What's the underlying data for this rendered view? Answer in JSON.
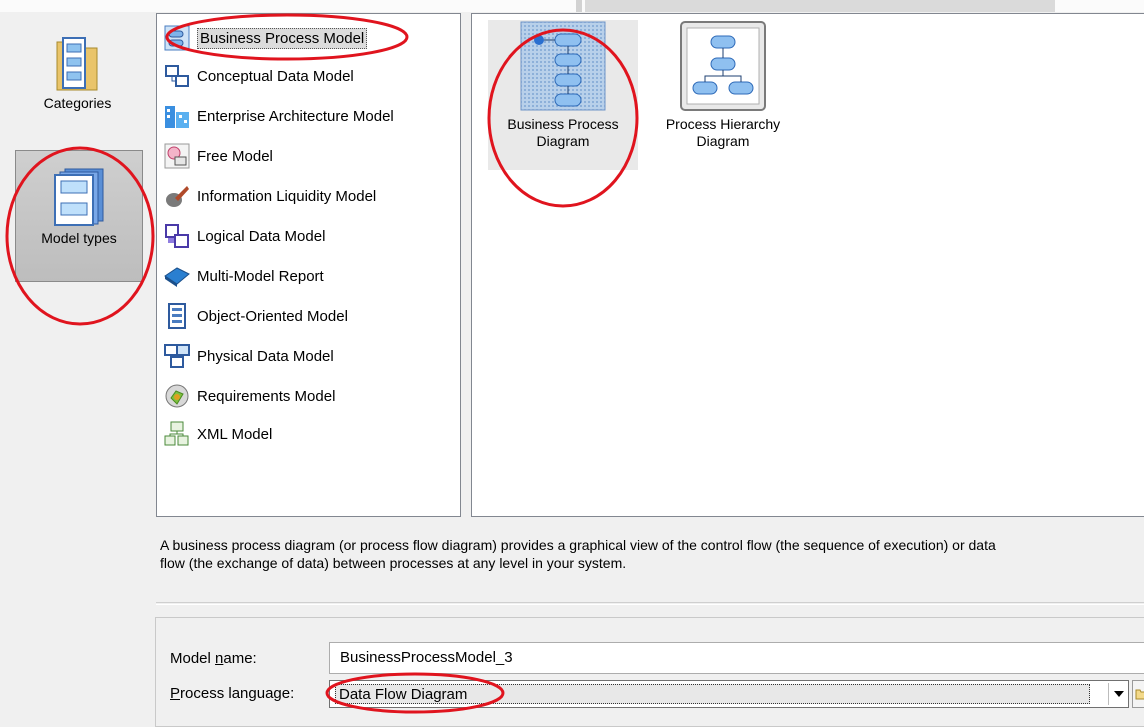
{
  "categories_bar": {
    "items": [
      {
        "label": "Categories",
        "icon": "folder-grid-icon"
      },
      {
        "label": "Model types",
        "icon": "stacked-models-icon",
        "selected": true
      }
    ]
  },
  "model_list": {
    "items": [
      {
        "label": "Business Process Model",
        "icon": "business-process-model-icon",
        "selected": true
      },
      {
        "label": "Conceptual Data Model",
        "icon": "conceptual-data-model-icon"
      },
      {
        "label": "Enterprise Architecture Model",
        "icon": "enterprise-architecture-model-icon"
      },
      {
        "label": "Free Model",
        "icon": "free-model-icon"
      },
      {
        "label": "Information Liquidity Model",
        "icon": "information-liquidity-model-icon"
      },
      {
        "label": "Logical Data Model",
        "icon": "logical-data-model-icon"
      },
      {
        "label": "Multi-Model Report",
        "icon": "multi-model-report-icon"
      },
      {
        "label": "Object-Oriented Model",
        "icon": "object-oriented-model-icon"
      },
      {
        "label": "Physical Data Model",
        "icon": "physical-data-model-icon"
      },
      {
        "label": "Requirements Model",
        "icon": "requirements-model-icon"
      },
      {
        "label": "XML Model",
        "icon": "xml-model-icon"
      }
    ]
  },
  "diagram_types": {
    "items": [
      {
        "label_line1": "Business Process",
        "label_line2": "Diagram",
        "icon": "business-process-diagram-icon",
        "selected": true
      },
      {
        "label_line1": "Process Hierarchy",
        "label_line2": "Diagram",
        "icon": "process-hierarchy-diagram-icon"
      }
    ]
  },
  "description": {
    "line1": "A business process diagram (or process flow diagram) provides a graphical view of the control flow (the sequence of execution) or data",
    "line2": "flow (the exchange of data) between processes at any level in your system."
  },
  "form": {
    "model_name_label_pre": "Model ",
    "model_name_label_u": "n",
    "model_name_label_post": "ame:",
    "model_name_value": "BusinessProcessModel_3",
    "process_language_label_u": "P",
    "process_language_label_post": "rocess language:",
    "process_language_value": "Data Flow Diagram"
  },
  "colors": {
    "annotation": "#e0141e",
    "selection": "#dcdcdc"
  }
}
